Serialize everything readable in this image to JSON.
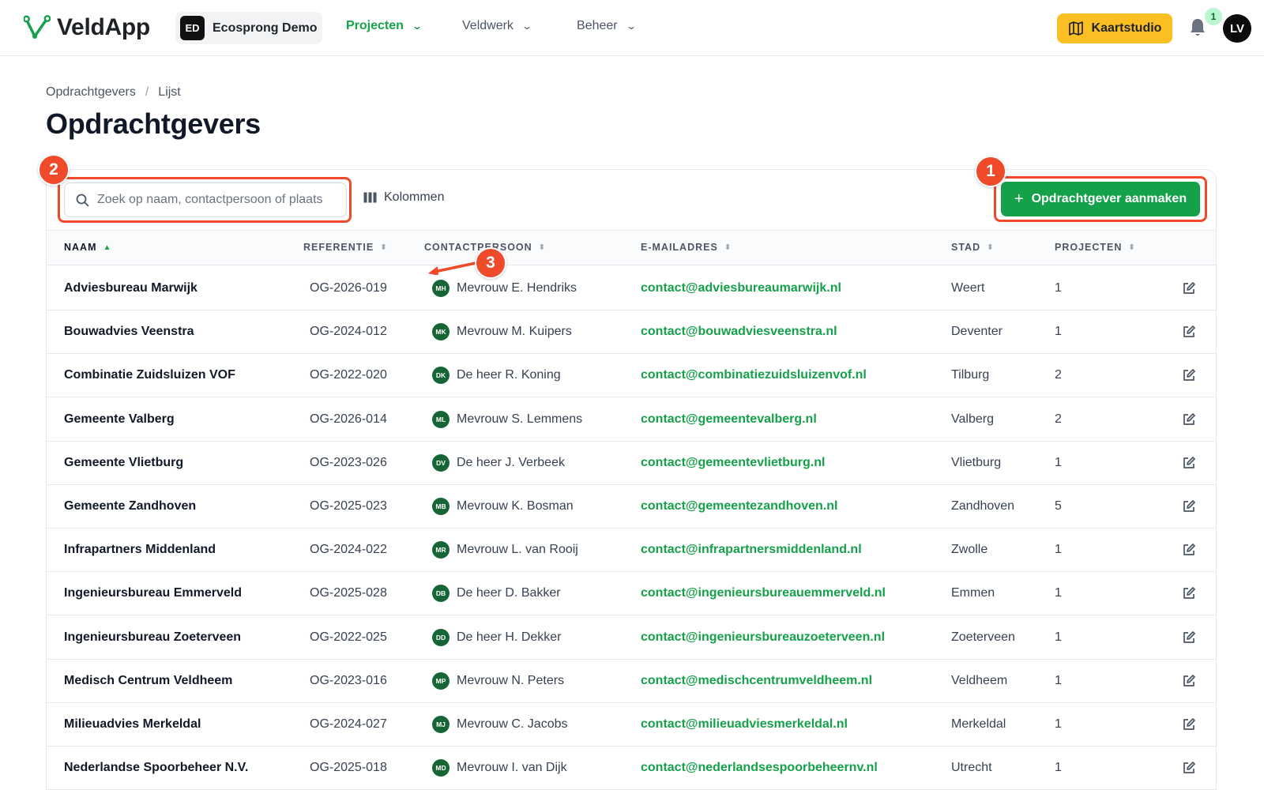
{
  "app": {
    "name": "VeldApp",
    "org_badge": "ED",
    "org_name": "Ecosprong Demo",
    "nav": [
      {
        "label": "Projecten",
        "active": true
      },
      {
        "label": "Veldwerk",
        "active": false
      },
      {
        "label": "Beheer",
        "active": false
      }
    ],
    "kaartstudio_label": "Kaartstudio",
    "notification_count": "1",
    "user_initials": "LV",
    "brand_color": "#15a04a",
    "accent_color": "#fbbf24"
  },
  "breadcrumb": [
    "Opdrachtgevers",
    "/",
    "Lijst"
  ],
  "page_title": "Opdrachtgevers",
  "toolbar": {
    "search_placeholder": "Zoek op naam, contactpersoon of plaats",
    "columns_label": "Kolommen",
    "add_label": "Opdrachtgever aanmaken"
  },
  "annotations": {
    "marker_1": "1",
    "marker_2": "2",
    "marker_3": "3",
    "color": "#ef4b2b"
  },
  "table": {
    "headers": {
      "naam": "NAAM",
      "referentie": "REFERENTIE",
      "contactpersoon": "CONTACTPERSOON",
      "email": "E-MAILADRES",
      "stad": "STAD",
      "projecten": "PROJECTEN"
    },
    "sort_asc": "▲",
    "sort_both": "⬍",
    "rows": [
      {
        "naam": "Adviesbureau Marwijk",
        "ref": "OG-2026-019",
        "initials": "MH",
        "contact": "Mevrouw E. Hendriks",
        "email": "contact@adviesbureaumarwijk.nl",
        "stad": "Weert",
        "projecten": "1"
      },
      {
        "naam": "Bouwadvies Veenstra",
        "ref": "OG-2024-012",
        "initials": "MK",
        "contact": "Mevrouw M. Kuipers",
        "email": "contact@bouwadviesveenstra.nl",
        "stad": "Deventer",
        "projecten": "1"
      },
      {
        "naam": "Combinatie Zuidsluizen VOF",
        "ref": "OG-2022-020",
        "initials": "DK",
        "contact": "De heer R. Koning",
        "email": "contact@combinatiezuidsluizenvof.nl",
        "stad": "Tilburg",
        "projecten": "2"
      },
      {
        "naam": "Gemeente Valberg",
        "ref": "OG-2026-014",
        "initials": "ML",
        "contact": "Mevrouw S. Lemmens",
        "email": "contact@gemeentevalberg.nl",
        "stad": "Valberg",
        "projecten": "2"
      },
      {
        "naam": "Gemeente Vlietburg",
        "ref": "OG-2023-026",
        "initials": "DV",
        "contact": "De heer J. Verbeek",
        "email": "contact@gemeentevlietburg.nl",
        "stad": "Vlietburg",
        "projecten": "1"
      },
      {
        "naam": "Gemeente Zandhoven",
        "ref": "OG-2025-023",
        "initials": "MB",
        "contact": "Mevrouw K. Bosman",
        "email": "contact@gemeentezandhoven.nl",
        "stad": "Zandhoven",
        "projecten": "5"
      },
      {
        "naam": "Infrapartners Middenland",
        "ref": "OG-2024-022",
        "initials": "MR",
        "contact": "Mevrouw L. van Rooij",
        "email": "contact@infrapartnersmiddenland.nl",
        "stad": "Zwolle",
        "projecten": "1"
      },
      {
        "naam": "Ingenieursbureau Emmerveld",
        "ref": "OG-2025-028",
        "initials": "DB",
        "contact": "De heer D. Bakker",
        "email": "contact@ingenieursbureauemmerveld.nl",
        "stad": "Emmen",
        "projecten": "1"
      },
      {
        "naam": "Ingenieursbureau Zoeterveen",
        "ref": "OG-2022-025",
        "initials": "DD",
        "contact": "De heer H. Dekker",
        "email": "contact@ingenieursbureauzoeterveen.nl",
        "stad": "Zoeterveen",
        "projecten": "1"
      },
      {
        "naam": "Medisch Centrum Veldheem",
        "ref": "OG-2023-016",
        "initials": "MP",
        "contact": "Mevrouw N. Peters",
        "email": "contact@medischcentrumveldheem.nl",
        "stad": "Veldheem",
        "projecten": "1"
      },
      {
        "naam": "Milieuadvies Merkeldal",
        "ref": "OG-2024-027",
        "initials": "MJ",
        "contact": "Mevrouw C. Jacobs",
        "email": "contact@milieuadviesmerkeldal.nl",
        "stad": "Merkeldal",
        "projecten": "1"
      },
      {
        "naam": "Nederlandse Spoorbeheer N.V.",
        "ref": "OG-2025-018",
        "initials": "MD",
        "contact": "Mevrouw I. van Dijk",
        "email": "contact@nederlandsespoorbeheernv.nl",
        "stad": "Utrecht",
        "projecten": "1"
      }
    ]
  }
}
